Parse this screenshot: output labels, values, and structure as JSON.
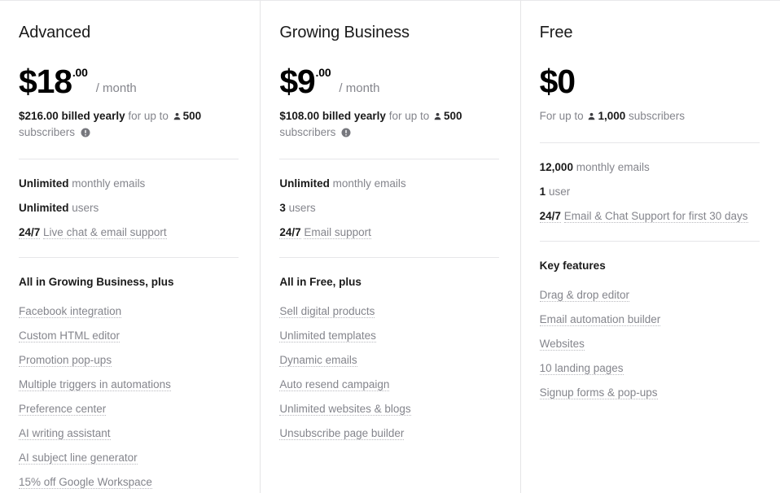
{
  "colors": {
    "text_dark": "#1a1a1a",
    "text_gray": "#84858c",
    "divider": "#e6e6e9",
    "column_border": "#e4e4e6",
    "dotted_underline": "#b9babf",
    "background": "#ffffff"
  },
  "plans": [
    {
      "name": "Advanced",
      "price_main": "$18",
      "price_cents": ".00",
      "price_period": "/ month",
      "billing": {
        "amount_text": "$216.00 billed yearly",
        "middle_text": "for up to",
        "person_icon": "person-icon",
        "subscriber_count": "500",
        "trailing_text": "subscribers",
        "info_icon": "info-icon",
        "has_info_icon": true
      },
      "core_features": [
        {
          "strong": "Unlimited",
          "rest": "monthly emails",
          "dotted": false
        },
        {
          "strong": "Unlimited",
          "rest": "users",
          "dotted": false
        },
        {
          "strong": "24/7",
          "rest": "Live chat & email support",
          "dotted": true
        }
      ],
      "group_title": "All in Growing Business, plus",
      "extra_features": [
        "Facebook integration",
        "Custom HTML editor",
        "Promotion pop-ups",
        "Multiple triggers in automations",
        "Preference center",
        "AI writing assistant",
        "AI subject line generator",
        "15% off Google Workspace"
      ]
    },
    {
      "name": "Growing Business",
      "price_main": "$9",
      "price_cents": ".00",
      "price_period": "/ month",
      "billing": {
        "amount_text": "$108.00 billed yearly",
        "middle_text": "for up to",
        "person_icon": "person-icon",
        "subscriber_count": "500",
        "trailing_text": "subscribers",
        "info_icon": "info-icon",
        "has_info_icon": true
      },
      "core_features": [
        {
          "strong": "Unlimited",
          "rest": "monthly emails",
          "dotted": false
        },
        {
          "strong": "3",
          "rest": "users",
          "dotted": false
        },
        {
          "strong": "24/7",
          "rest": "Email support",
          "dotted": true
        }
      ],
      "group_title": "All in Free, plus",
      "extra_features": [
        "Sell digital products",
        "Unlimited templates",
        "Dynamic emails",
        "Auto resend campaign",
        "Unlimited websites & blogs",
        "Unsubscribe page builder"
      ]
    },
    {
      "name": "Free",
      "price_main": "$0",
      "price_cents": "",
      "price_period": "",
      "billing": {
        "amount_text": "",
        "middle_text": "For up to",
        "person_icon": "person-icon",
        "subscriber_count": "1,000",
        "trailing_text": "subscribers",
        "info_icon": "info-icon",
        "has_info_icon": false
      },
      "core_features": [
        {
          "strong": "12,000",
          "rest": "monthly emails",
          "dotted": false
        },
        {
          "strong": "1",
          "rest": "user",
          "dotted": false
        },
        {
          "strong": "24/7",
          "rest": "Email & Chat Support for first 30 days",
          "dotted": true
        }
      ],
      "group_title": "Key features",
      "extra_features": [
        "Drag & drop editor",
        "Email automation builder",
        "Websites",
        "10 landing pages",
        "Signup forms & pop-ups"
      ]
    }
  ]
}
